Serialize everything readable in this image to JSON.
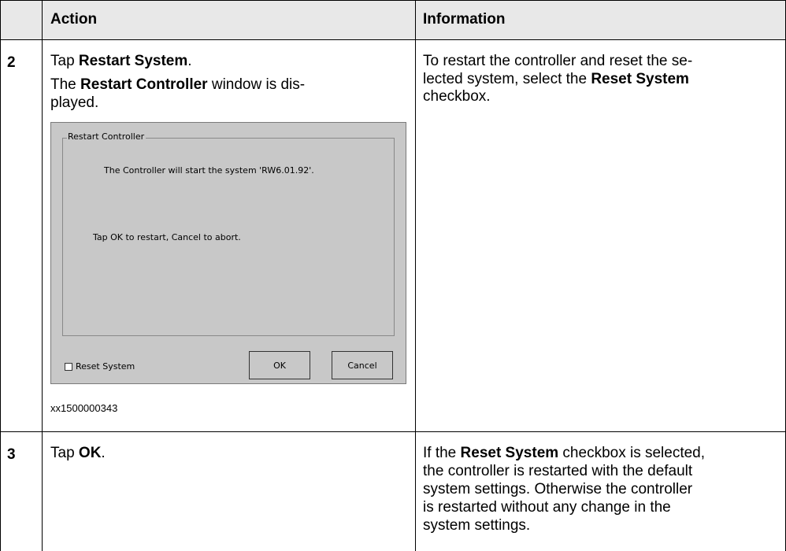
{
  "header": {
    "action": "Action",
    "information": "Information"
  },
  "rows": [
    {
      "step": "2",
      "action_lines": [
        {
          "pre": "Tap ",
          "bold": "Restart System",
          "post": "."
        },
        {
          "pre": "The ",
          "bold": "Restart Controller",
          "post": " window is dis-"
        },
        {
          "pre": "",
          "bold": "",
          "post": "played."
        }
      ],
      "information_lines": [
        {
          "pre": "To restart the controller and reset the se-",
          "bold": "",
          "post": ""
        },
        {
          "pre": "lected system, select the ",
          "bold": "Reset System",
          "post": ""
        },
        {
          "pre": "checkbox.",
          "bold": "",
          "post": ""
        }
      ],
      "caption": "xx1500000343",
      "dialog": {
        "group_title": "Restart Controller",
        "message_1": "The Controller will start the system 'RW6.01.92'.",
        "message_2": "Tap OK to restart, Cancel to abort.",
        "checkbox_label": "Reset System",
        "ok_label": "OK",
        "cancel_label": "Cancel"
      }
    },
    {
      "step": "3",
      "action_lines": [
        {
          "pre": "Tap ",
          "bold": "OK",
          "post": "."
        }
      ],
      "information_lines": [
        {
          "pre": "If the ",
          "bold": "Reset System",
          "post": " checkbox is selected,"
        },
        {
          "pre": "the controller is restarted with the default",
          "bold": "",
          "post": ""
        },
        {
          "pre": "system settings. Otherwise the controller",
          "bold": "",
          "post": ""
        },
        {
          "pre": "is restarted without any change in the",
          "bold": "",
          "post": ""
        },
        {
          "pre": "system settings.",
          "bold": "",
          "post": ""
        }
      ]
    }
  ]
}
